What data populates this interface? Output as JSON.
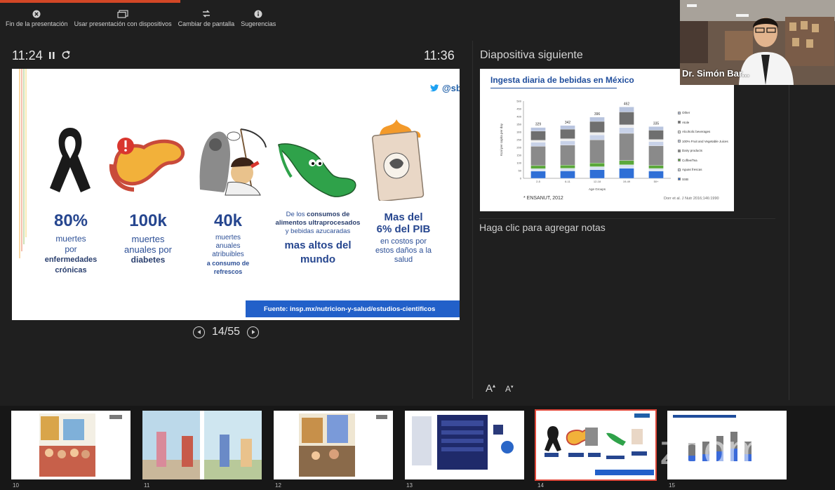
{
  "toolbar": {
    "end_show": "Fin de la presentación",
    "use_with_devices": "Usar presentación con dispositivos",
    "switch_screen": "Cambiar de pantalla",
    "suggestions": "Sugerencias"
  },
  "presenter": {
    "elapsed": "11:24",
    "clock": "11:36",
    "next_slide_label": "Diapositiva siguiente",
    "notes_placeholder": "Haga clic para agregar notas",
    "font_up": "A",
    "font_down": "A",
    "page": "14/55"
  },
  "slide": {
    "handle": "@sbarquera",
    "stats": [
      {
        "value": "80%",
        "line1": "muertes",
        "line2": "por",
        "bold": "enfermedades crónicas"
      },
      {
        "value": "100k",
        "line1": "muertes",
        "line2": "anuales por",
        "bold": "diabetes"
      },
      {
        "value": "40k",
        "line1": "muertes",
        "line2": "anuales",
        "line3": "atribuibles",
        "bold": "a consumo de refrescos"
      }
    ],
    "mexico": {
      "pre": "De los",
      "b1": "consumos de alimentos ultraprocesados",
      "mid": "y bebidas azucaradas",
      "big": "mas altos del mundo"
    },
    "pib": {
      "big1": "Mas del",
      "big2": "6% del PIB",
      "rest": "en costos por estos daños a la salud"
    },
    "source": "Fuente: insp.mx/nutricion-y-salud/estudios-cientificos"
  },
  "next_slide": {
    "title": "Ingesta diaria de bebidas en México",
    "foot_left": "* ENSANUT, 2012",
    "foot_right": "Dorr et al. J Nutr 2016;146:1990",
    "xlabel": "Age Groups",
    "ylabel": "Kcal per capita per day",
    "chart_data": {
      "type": "bar",
      "categories": [
        "2-5",
        "6-11",
        "12-18",
        "19-49",
        "50+"
      ],
      "totals": [
        329,
        342,
        396,
        462,
        335
      ],
      "ylim": [
        0,
        500
      ]
    },
    "legend": [
      "Other",
      "Atole",
      "Alcoholic beverages",
      "100% Fruit and Vegetable Juices",
      "Dairy products",
      "Coffee/Tea",
      "Aguas frescas",
      "SSB"
    ]
  },
  "video": {
    "name": "Dr. Simón Bar..."
  },
  "thumbnails": [
    {
      "num": "10"
    },
    {
      "num": "11"
    },
    {
      "num": "12"
    },
    {
      "num": "13"
    },
    {
      "num": "14"
    },
    {
      "num": "15"
    }
  ],
  "watermark": "zoom"
}
